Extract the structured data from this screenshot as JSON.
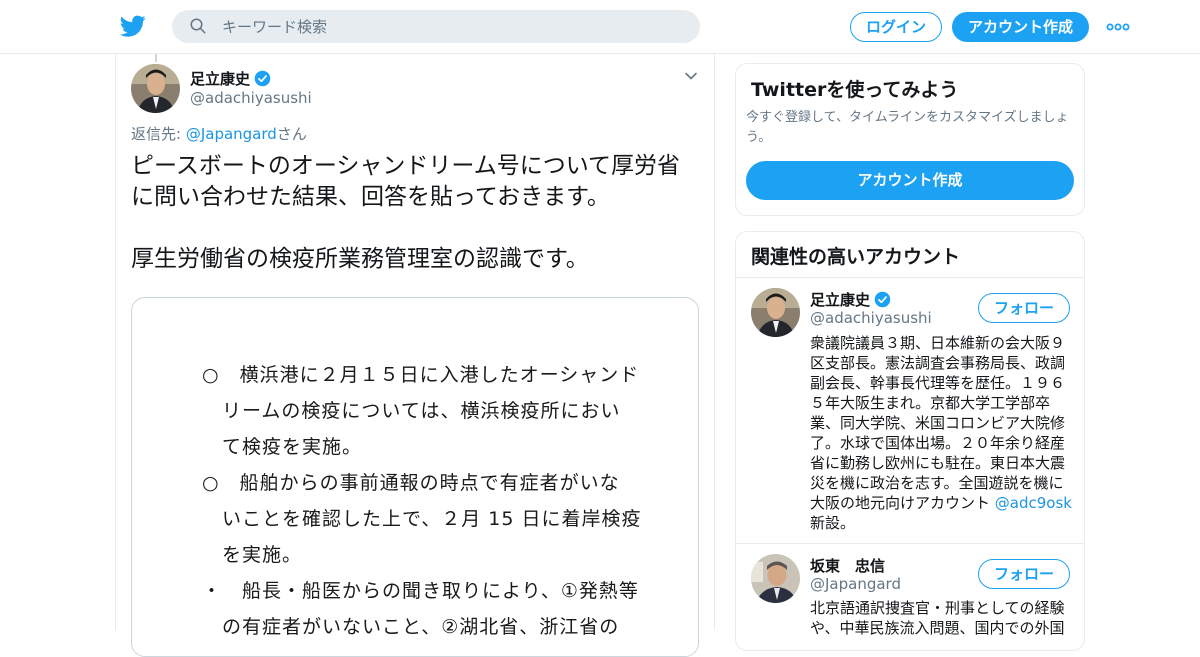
{
  "header": {
    "search_placeholder": "キーワード検索",
    "login_label": "ログイン",
    "signup_label": "アカウント作成"
  },
  "tweet": {
    "author_name": "足立康史",
    "author_handle": "@adachiyasushi",
    "reply_prefix": "返信先: ",
    "reply_to": "@Japangard",
    "reply_suffix": "さん",
    "text_p1_l1": "ピースボートのオーシャンドリーム号について厚労省",
    "text_p1_l2": "に問い合わせた結果、回答を貼っておきます。",
    "text_p2": "厚生労働省の検疫所業務管理室の認識です。",
    "image_lines": [
      "○　横浜港に２月１５日に入港したオーシャンド",
      "　リームの検疫については、横浜検疫所におい",
      "　て検疫を実施。",
      "○　船舶からの事前通報の時点で有症者がいな",
      "　いことを確認した上で、２月 15 日に着岸検疫",
      "　を実施。",
      "・　船長・船医からの聞き取りにより、①発熱等",
      "　の有症者がいないこと、②湖北省、浙江省の"
    ]
  },
  "sidebar": {
    "try_card": {
      "title": "Twitterを使ってみよう",
      "subtitle_l1": "今すぐ登録して、タイムラインをカスタマイズしましょ",
      "subtitle_l2": "う。",
      "button": "アカウント作成"
    },
    "related": {
      "title": "関連性の高いアカウント",
      "follow_label": "フォロー",
      "accounts": [
        {
          "name": "足立康史",
          "handle": "@adachiyasushi",
          "bio_lines": [
            "衆議院議員３期、日本維新の会大阪９",
            "区支部長。憲法調査会事務局長、政調",
            "副会長、幹事長代理等を歴任。１９６",
            "５年大阪生まれ。京都大学工学部卒",
            "業、同大学院、米国コロンビア大院修",
            "了。水球で国体出場。２０年余り経産",
            "省に勤務し欧州にも駐在。東日本大震",
            "災を機に政治を志す。全国遊説を機に"
          ],
          "bio_last_prefix": "大阪の地元向けアカウント ",
          "bio_last_link": "@adc9osk",
          "bio_end": "新設。"
        },
        {
          "name": "坂東　忠信",
          "handle": "@Japangard",
          "bio_lines": [
            "北京語通訳捜査官・刑事としての経験",
            "や、中華民族流入問題、国内での外国"
          ]
        }
      ]
    }
  },
  "colors": {
    "accent": "#1da1f2",
    "link": "#1b95e0",
    "muted": "#657786"
  }
}
